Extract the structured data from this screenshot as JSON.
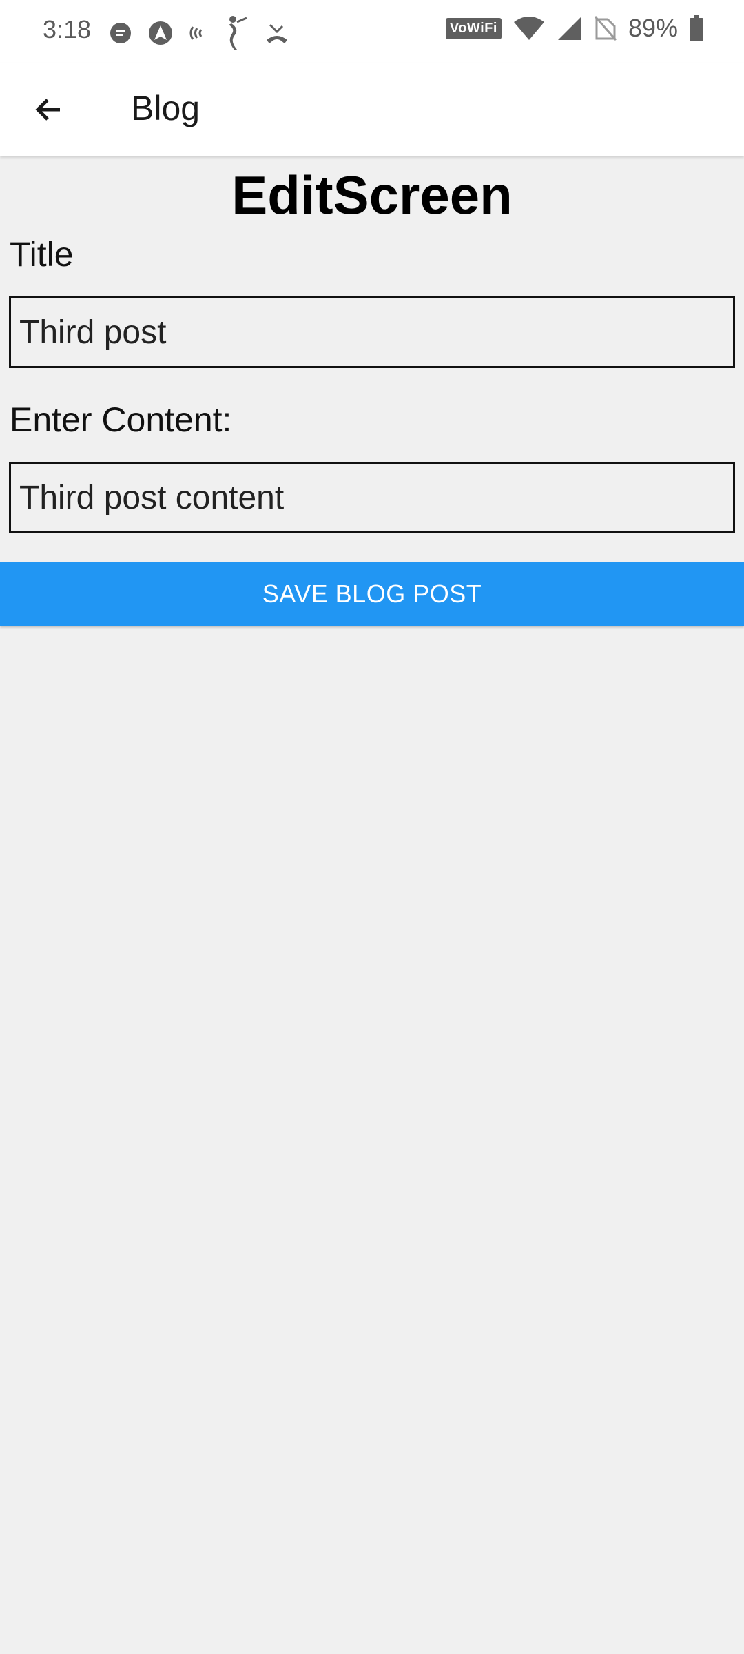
{
  "status_bar": {
    "time": "3:18",
    "left_icons": [
      "message-icon",
      "nav-icon",
      "radio-waves-icon",
      "cricket-icon",
      "missed-call-icon"
    ],
    "vowifi_label": "VoWiFi",
    "battery_percent": "89%"
  },
  "app_bar": {
    "back_icon": "arrow-left-icon",
    "title": "Blog"
  },
  "screen": {
    "heading": "EditScreen",
    "title_label": "Title",
    "title_value": "Third post",
    "content_label": "Enter Content:",
    "content_value": "Third post content",
    "save_label": "SAVE BLOG POST"
  },
  "colors": {
    "accent": "#2196f3",
    "background": "#f0f0f0"
  }
}
